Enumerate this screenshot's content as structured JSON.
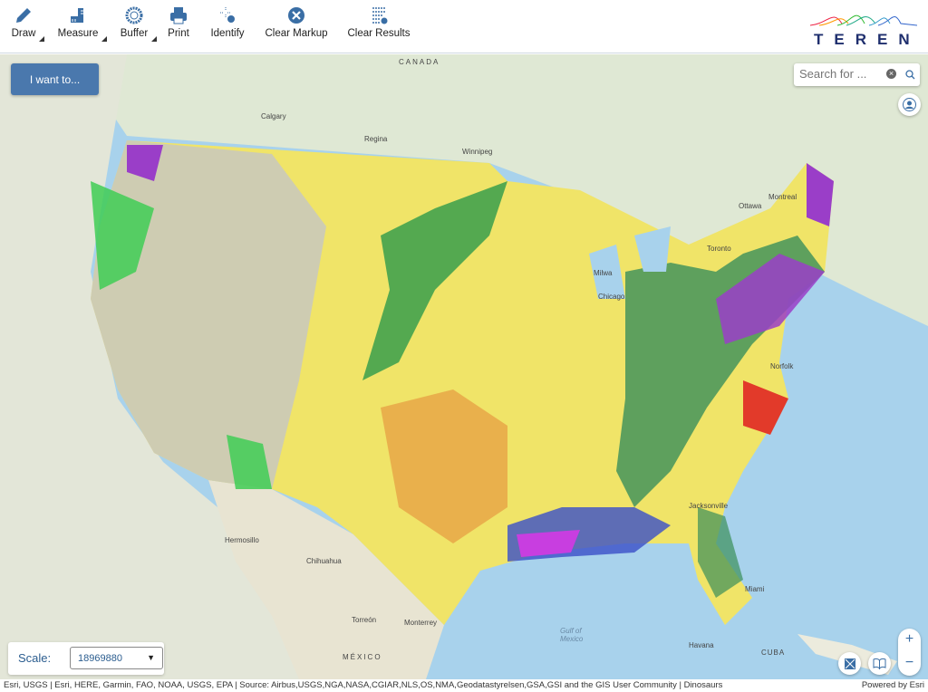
{
  "toolbar": {
    "tools": [
      {
        "label": "Draw",
        "icon": "pencil-icon",
        "dropdown": true
      },
      {
        "label": "Measure",
        "icon": "ruler-icon",
        "dropdown": true
      },
      {
        "label": "Buffer",
        "icon": "buffer-icon",
        "dropdown": true
      },
      {
        "label": "Print",
        "icon": "printer-icon",
        "dropdown": false
      },
      {
        "label": "Identify",
        "icon": "identify-icon",
        "dropdown": false
      },
      {
        "label": "Clear Markup",
        "icon": "close-circle-icon",
        "dropdown": false
      },
      {
        "label": "Clear Results",
        "icon": "clear-list-icon",
        "dropdown": false
      }
    ]
  },
  "logo": {
    "text": "TEREN"
  },
  "map": {
    "i_want_label": "I want to...",
    "search_placeholder": "Search for ...",
    "labels": {
      "canada": "CANADA",
      "calgary": "Calgary",
      "regina": "Regina",
      "winnipeg": "Winnipeg",
      "ottawa": "Ottawa",
      "montreal": "Montreal",
      "toronto": "Toronto",
      "chicago": "Chicago",
      "milwaukee": "Milwa",
      "norfolk": "Norfolk",
      "jacksonville": "Jacksonville",
      "miami": "Miami",
      "havana": "Havana",
      "cuba": "CUBA",
      "gulf": "Gulf of Mexico",
      "hermosillo": "Hermosillo",
      "chihuahua": "Chihuahua",
      "torreon": "Torreón",
      "monterrey": "Monterrey",
      "mexico": "MÉXICO"
    },
    "scale_label": "Scale:",
    "scale_value": "18969880",
    "zoom_in": "+",
    "zoom_out": "−"
  },
  "attribution": {
    "text": "Esri, USGS | Esri, HERE, Garmin, FAO, NOAA, USGS, EPA | Source: Airbus,USGS,NGA,NASA,CGIAR,NLS,OS,NMA,Geodatastyrelsen,GSA,GSI and the GIS User Community | Dinosaurs",
    "powered": "Powered by Esri"
  },
  "colors": {
    "accent": "#3a6ea5",
    "button": "#4a78ad",
    "logo": "#1f2f6e"
  }
}
